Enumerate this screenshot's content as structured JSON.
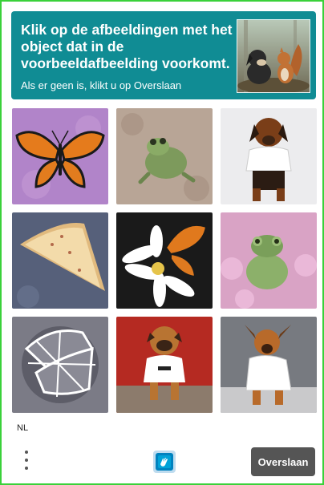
{
  "header": {
    "title": "Klik op de afbeeldingen met het object dat in de voorbeeldafbeelding voorkomt.",
    "subtitle": "Als er geen is, klikt u op Overslaan",
    "example_image": "dog-and-squirrel-in-forest"
  },
  "grid": {
    "tiles": [
      {
        "subject": "butterfly"
      },
      {
        "subject": "frog"
      },
      {
        "subject": "dog-in-tshirt"
      },
      {
        "subject": "pizza-slice"
      },
      {
        "subject": "butterfly-on-flower"
      },
      {
        "subject": "frog-with-flowers"
      },
      {
        "subject": "sliced-pizza-outline"
      },
      {
        "subject": "pug-in-tshirt"
      },
      {
        "subject": "dog-in-tshirt"
      }
    ]
  },
  "footer": {
    "language": "NL",
    "skip_label": "Overslaan",
    "menu_icon": "more-vertical-icon",
    "logo_icon": "hcaptcha-logo-icon"
  },
  "colors": {
    "accent": "#108c94",
    "border": "#3ad13a",
    "skip_button": "#555555"
  }
}
